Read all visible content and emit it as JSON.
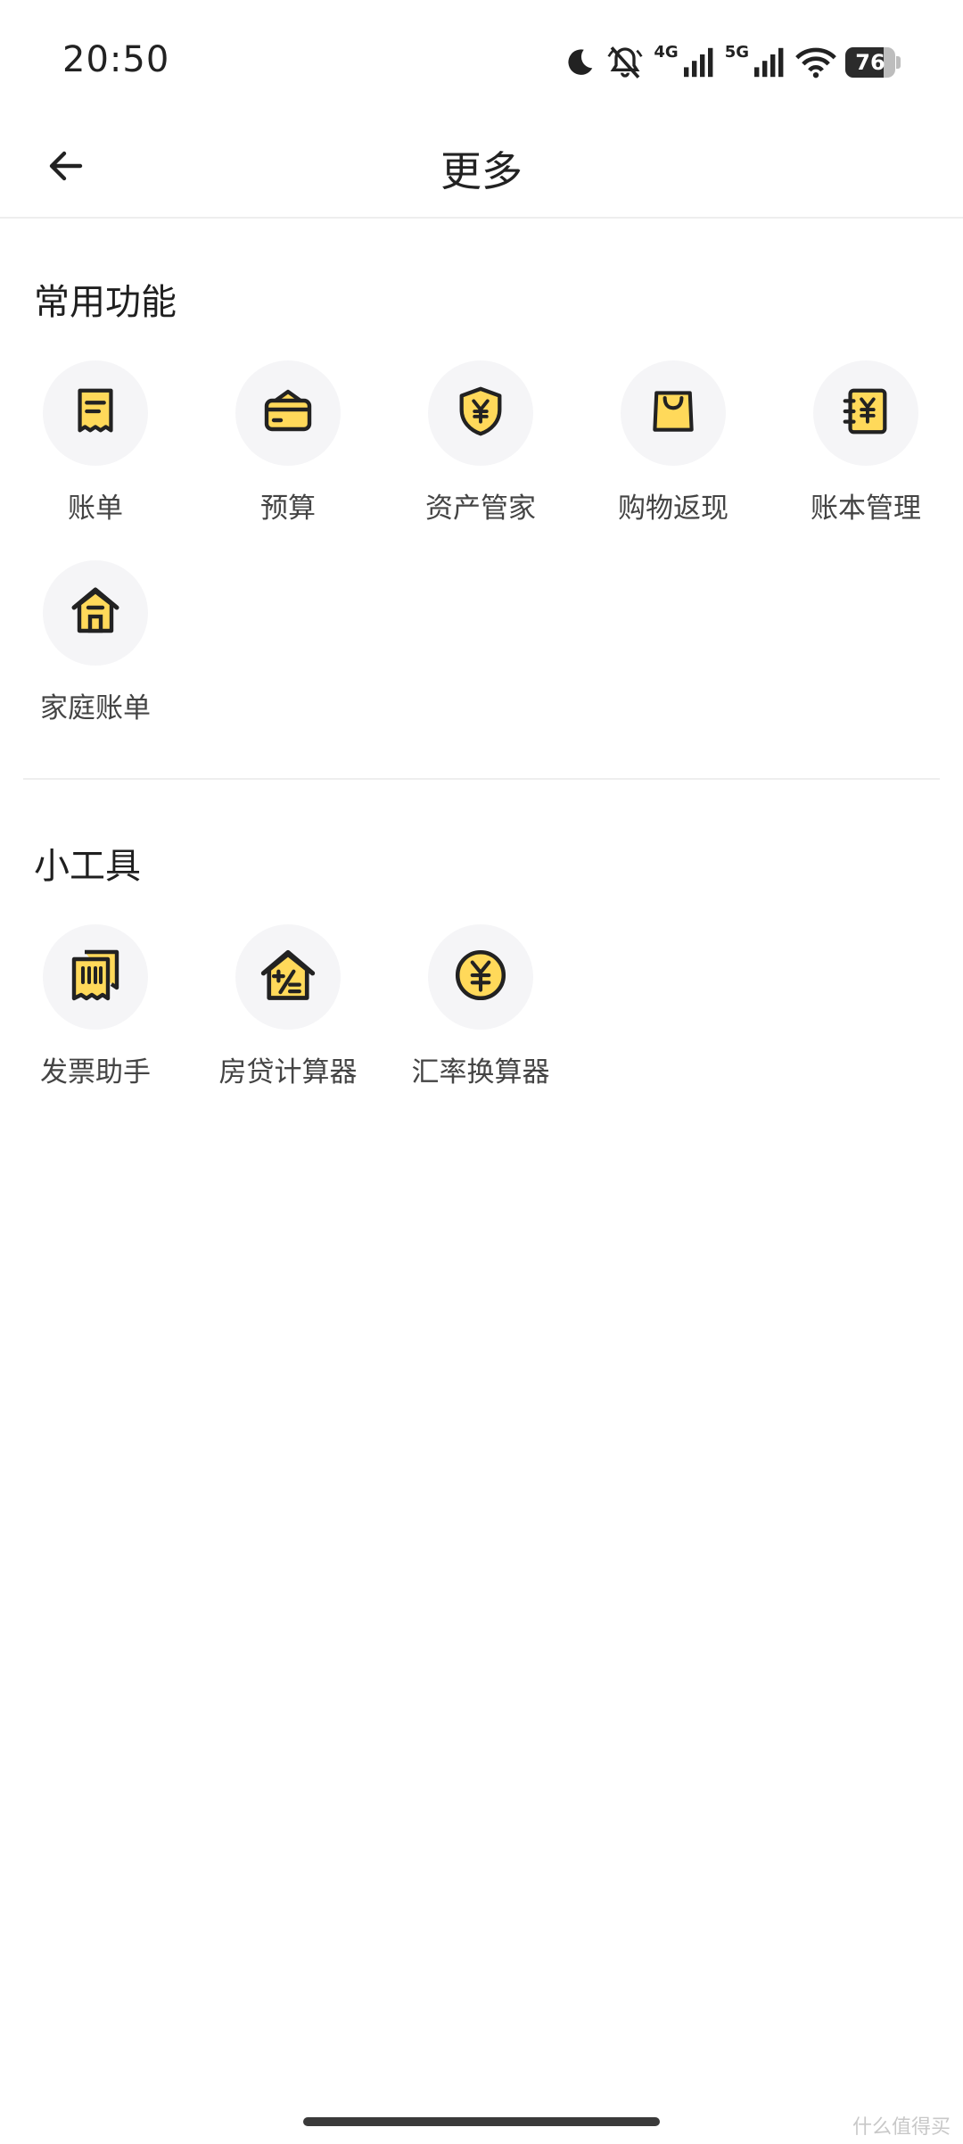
{
  "status_bar": {
    "time": "20:50",
    "net_4g": "4G",
    "net_5g": "5G",
    "battery_level": 76,
    "battery_text": "76",
    "icons": [
      "moon-icon",
      "bell-muted-icon",
      "signal-4g-icon",
      "signal-5g-icon",
      "wifi-icon",
      "battery-icon"
    ]
  },
  "nav": {
    "title": "更多",
    "back_icon": "arrow-left-icon"
  },
  "sections": {
    "common": {
      "title": "常用功能",
      "items": [
        {
          "label": "账单",
          "icon": "receipt-icon"
        },
        {
          "label": "预算",
          "icon": "wallet-icon"
        },
        {
          "label": "资产管家",
          "icon": "shield-yen-icon"
        },
        {
          "label": "购物返现",
          "icon": "shopping-bag-icon"
        },
        {
          "label": "账本管理",
          "icon": "ledger-book-icon"
        },
        {
          "label": "家庭账单",
          "icon": "house-icon"
        }
      ]
    },
    "tools": {
      "title": "小工具",
      "items": [
        {
          "label": "发票助手",
          "icon": "invoice-icon"
        },
        {
          "label": "房贷计算器",
          "icon": "mortgage-calculator-icon"
        },
        {
          "label": "汇率换算器",
          "icon": "yen-coin-icon"
        }
      ]
    }
  },
  "watermark": "什么值得买",
  "colors": {
    "accent_yellow": "#FFD95A",
    "icon_stroke": "#222222",
    "tile_bg": "#F5F5F7"
  }
}
